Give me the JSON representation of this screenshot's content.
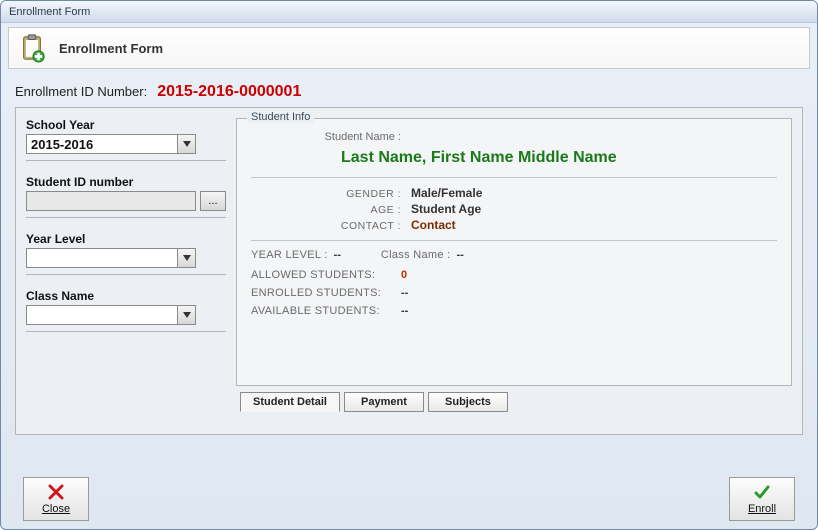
{
  "window": {
    "title": "Enrollment Form"
  },
  "header": {
    "title": "Enrollment Form"
  },
  "enrollment_id": {
    "label": "Enrollment ID Number:",
    "value": "2015-2016-0000001"
  },
  "form": {
    "school_year": {
      "label": "School Year",
      "value": "2015-2016"
    },
    "student_id": {
      "label": "Student ID number",
      "value": "",
      "browse": "..."
    },
    "year_level": {
      "label": "Year Level",
      "value": ""
    },
    "class_name": {
      "label": "Class Name",
      "value": ""
    }
  },
  "student_info": {
    "legend": "Student Info",
    "name_label": "Student Name :",
    "name_value": "Last Name, First Name Middle Name",
    "gender_label": "GENDER :",
    "gender_value": "Male/Female",
    "age_label": "AGE :",
    "age_value": "Student Age",
    "contact_label": "CONTACT :",
    "contact_value": "Contact",
    "year_level_label": "YEAR LEVEL :",
    "year_level_value": "--",
    "class_name_label": "Class Name :",
    "class_name_value": "--",
    "allowed_label": "ALLOWED STUDENTS:",
    "allowed_value": "0",
    "enrolled_label": "ENROLLED STUDENTS:",
    "enrolled_value": "--",
    "available_label": "AVAILABLE STUDENTS:",
    "available_value": "--"
  },
  "tabs": {
    "detail": "Student Detail",
    "payment": "Payment",
    "subjects": "Subjects"
  },
  "buttons": {
    "close": "Close",
    "enroll": "Enroll"
  }
}
